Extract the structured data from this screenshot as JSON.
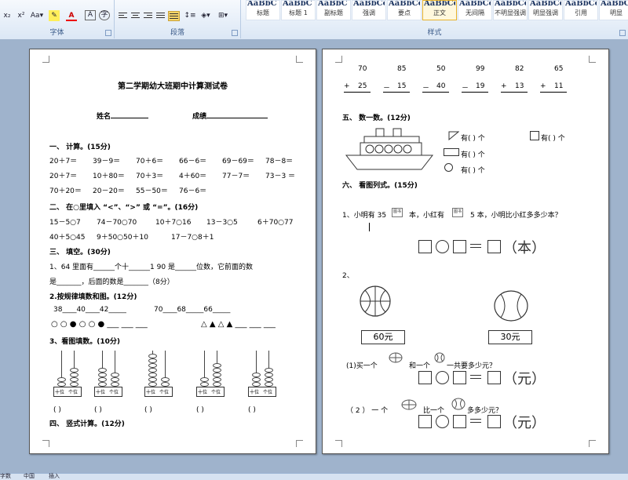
{
  "ribbon": {
    "font_group_label": "字体",
    "paragraph_group_label": "段落",
    "styles_group_label": "样式",
    "font_buttons": [
      "x₂",
      "x²",
      "Aa▾"
    ],
    "styles": [
      {
        "sample": "AaBbC",
        "name": "标题",
        "selected": false
      },
      {
        "sample": "AaBbC",
        "name": "标题 1",
        "selected": false
      },
      {
        "sample": "AaBbC",
        "name": "副标题",
        "selected": false
      },
      {
        "sample": "AaBbCcD",
        "name": "强调",
        "selected": false
      },
      {
        "sample": "AaBbCcD",
        "name": "要点",
        "selected": false
      },
      {
        "sample": "AaBbCcDı",
        "name": "正文",
        "selected": true
      },
      {
        "sample": "AaBbCcDı",
        "name": "无间隔",
        "selected": false
      },
      {
        "sample": "AaBbCcDı",
        "name": "不明显强调",
        "selected": false
      },
      {
        "sample": "AaBbCcDı",
        "name": "明显强调",
        "selected": false
      },
      {
        "sample": "AaBbCcDı",
        "name": "引用",
        "selected": false
      },
      {
        "sample": "AaBbCcDı",
        "name": "明显",
        "selected": false
      }
    ]
  },
  "page1": {
    "title": "第二学期幼大班期中计算测试卷",
    "name_label": "姓名",
    "score_label": "成绩",
    "s1_title": "一、 计算。(15分)",
    "s1_rows": [
      [
        "20＋7＝",
        "39－9＝",
        "70＋6＝",
        "66－6＝",
        "69－69＝",
        "78－8＝"
      ],
      [
        "20＋7＝",
        "10＋80＝",
        "70＋3＝",
        "4＋60＝",
        "77－7＝",
        "73－3 ＝"
      ],
      [
        "70＋20＝",
        "20－20＝",
        "55－50＝",
        "76－6＝"
      ]
    ],
    "s2_title": "二、 在○里填入 “<”、“>” 或 “=”。(16分)",
    "s2_rows": [
      [
        "15－5○7",
        "74－70○70",
        "10＋7○16",
        "13－3○5",
        "6＋70○77"
      ],
      [
        "40＋5○45",
        "9＋50○50＋10",
        "17－7○8＋1"
      ]
    ],
    "s3_title": "三、 填空。(30分)",
    "s3_q1a": "1、64 里面有______个十______1    90  是______位数，它前面的数",
    "s3_q1b": "是_______，后面的数是_______（8分）",
    "s3_q2_title": "2.按规律填数和图。(12分)",
    "s3_q2_seq1": "38____40____42_____",
    "s3_q2_seq2": "70____68_____66_____",
    "s3_q2_shapes1": "○ ○ ● ○ ○ ● ___  ___  ___",
    "s3_q2_shapes2": "△ ▲ △ ▲ ___ ___ ___",
    "s3_q3_title": "3、看图填数。(10分)",
    "abacus_labels": [
      "十位",
      "个位"
    ],
    "abacus_paren": "(      )",
    "s4_title": "四、 竖式计算。(12分)"
  },
  "page2": {
    "vertical": [
      {
        "top": "70",
        "op": "+",
        "bottom": "25"
      },
      {
        "top": "85",
        "op": "－",
        "bottom": "15"
      },
      {
        "top": "50",
        "op": "－",
        "bottom": "40"
      },
      {
        "top": "99",
        "op": "－",
        "bottom": "19"
      },
      {
        "top": "82",
        "op": "+",
        "bottom": "13"
      },
      {
        "top": "65",
        "op": "+",
        "bottom": "11"
      }
    ],
    "s5_title": "五、 数一数。(12分)",
    "count_items": [
      "有(     ) 个",
      "有(     ) 个",
      "有(     ) 个",
      "有(     ) 个"
    ],
    "s6_title": "六、 看图列式。(15分)",
    "q1_text_a": "1、小明有 35",
    "q1_text_b": "本，小红有",
    "q1_text_c": "5 本，小明比小红多多少本？",
    "q1_img_label": "图书",
    "q1_unit": "（本）",
    "q2_label": "2、",
    "price1": "60元",
    "price2": "30元",
    "q2a_text_a": "(1)买一个",
    "q2a_text_b": "和一个",
    "q2a_text_c": "一共要多少元？",
    "q2_unit": "（元）",
    "q2b_text_a": "（ 2 ） 一 个",
    "q2b_text_b": "比一个",
    "q2b_text_c": "多多少元？"
  },
  "status": {
    "items": [
      "字数",
      "中国",
      "插入"
    ]
  }
}
